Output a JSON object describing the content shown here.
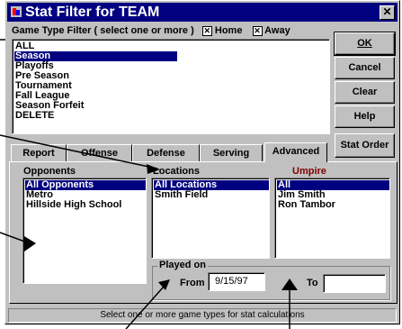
{
  "window": {
    "title": "Stat Filter for TEAM"
  },
  "game_type": {
    "label": "Game Type Filter ( select one or more )",
    "home_label": "Home",
    "home_checked": true,
    "away_label": "Away",
    "away_checked": true,
    "items": [
      "ALL",
      "Season",
      "Playoffs",
      "Pre Season",
      "Tournament",
      "Fall League",
      "Season Forfeit",
      "DELETE"
    ],
    "selected_index": 1
  },
  "buttons": {
    "ok": "OK",
    "cancel": "Cancel",
    "clear": "Clear",
    "help": "Help",
    "stat_order": "Stat Order"
  },
  "tabs": [
    "Report",
    "Offense",
    "Defense",
    "Serving",
    "Advanced"
  ],
  "active_tab": "Advanced",
  "opponents": {
    "label": "Opponents",
    "items": [
      "All Opponents",
      "Metro",
      "Hillside High School"
    ],
    "selected_index": 0
  },
  "locations": {
    "label": "Locations",
    "items": [
      "All Locations",
      "Smith Field"
    ],
    "selected_index": 0
  },
  "umpire": {
    "label": "Umpire",
    "label_color": "#800000",
    "items": [
      "All",
      "Jim Smith",
      "Ron Tambor"
    ],
    "selected_index": 0
  },
  "played_on": {
    "label": "Played on",
    "from_label": "From",
    "from_value": "9/15/97",
    "to_label": "To",
    "to_value": ""
  },
  "status": "Select one or more game types for stat calculations",
  "colors": {
    "title_bar": "#000080",
    "face": "#c0c0c0",
    "selection": "#000080"
  }
}
